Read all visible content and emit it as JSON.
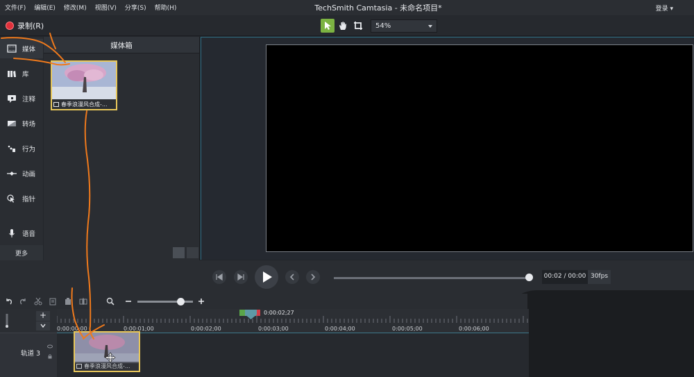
{
  "menubar": {
    "items": [
      "文件(F)",
      "编辑(E)",
      "修改(M)",
      "视图(V)",
      "分享(S)",
      "帮助(H)"
    ],
    "app_title": "TechSmith Camtasia - 未命名项目*",
    "login": "登录"
  },
  "toolbar": {
    "record_label": "录制(R)",
    "zoom": "54%"
  },
  "sidebar": {
    "items": [
      {
        "label": "媒体",
        "icon": "film-icon"
      },
      {
        "label": "库",
        "icon": "library-icon"
      },
      {
        "label": "注释",
        "icon": "callout-icon"
      },
      {
        "label": "转场",
        "icon": "transition-icon"
      },
      {
        "label": "行为",
        "icon": "behavior-icon"
      },
      {
        "label": "动画",
        "icon": "animation-icon"
      },
      {
        "label": "指针",
        "icon": "cursor-effect-icon"
      },
      {
        "label": "语音",
        "icon": "microphone-icon"
      }
    ],
    "more_label": "更多"
  },
  "media_bin": {
    "title": "媒体箱",
    "clip_name": "春季浪漫风合成-..."
  },
  "playback": {
    "time": "00:02 / 00:00",
    "fps": "30fps"
  },
  "timeline": {
    "playhead_time": "0:00:02;27",
    "ticks": [
      "0:00:00;00",
      "0:00:01;00",
      "0:00:02;00",
      "0:00:03;00",
      "0:00:04;00",
      "0:00:05;00",
      "0:00:06;00"
    ],
    "track_label": "轨道 3",
    "clip_name": "春季浪漫风合成-..."
  },
  "colors": {
    "accent_green": "#7cb342",
    "record_red": "#e0303a",
    "clip_border": "#e8c75a",
    "annotation_orange": "#f07a1c"
  }
}
